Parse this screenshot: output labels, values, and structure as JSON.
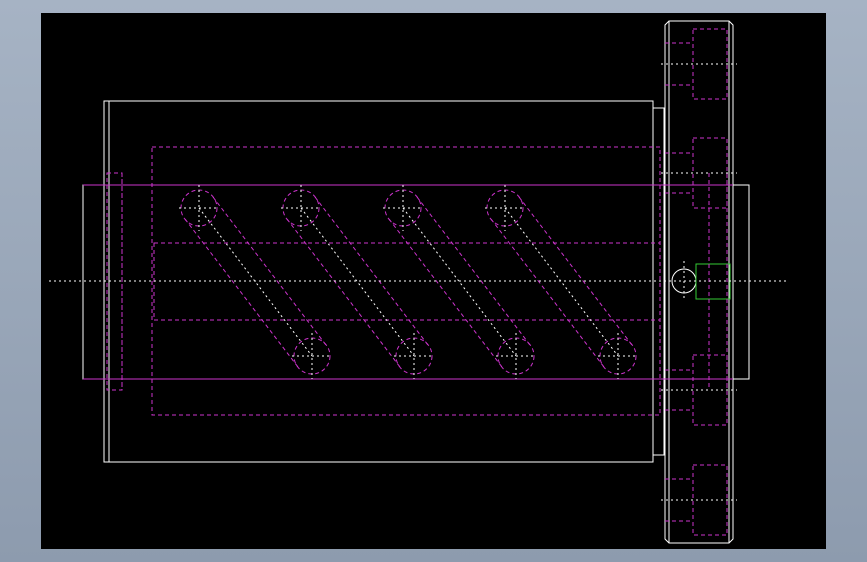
{
  "colors": {
    "outline": "#ffffff",
    "hidden": "#cc33cc",
    "centerline": "#ffffff",
    "key": "#33cc33",
    "canvas": "#000000"
  },
  "drawing": {
    "helical_slot_count": 4
  }
}
